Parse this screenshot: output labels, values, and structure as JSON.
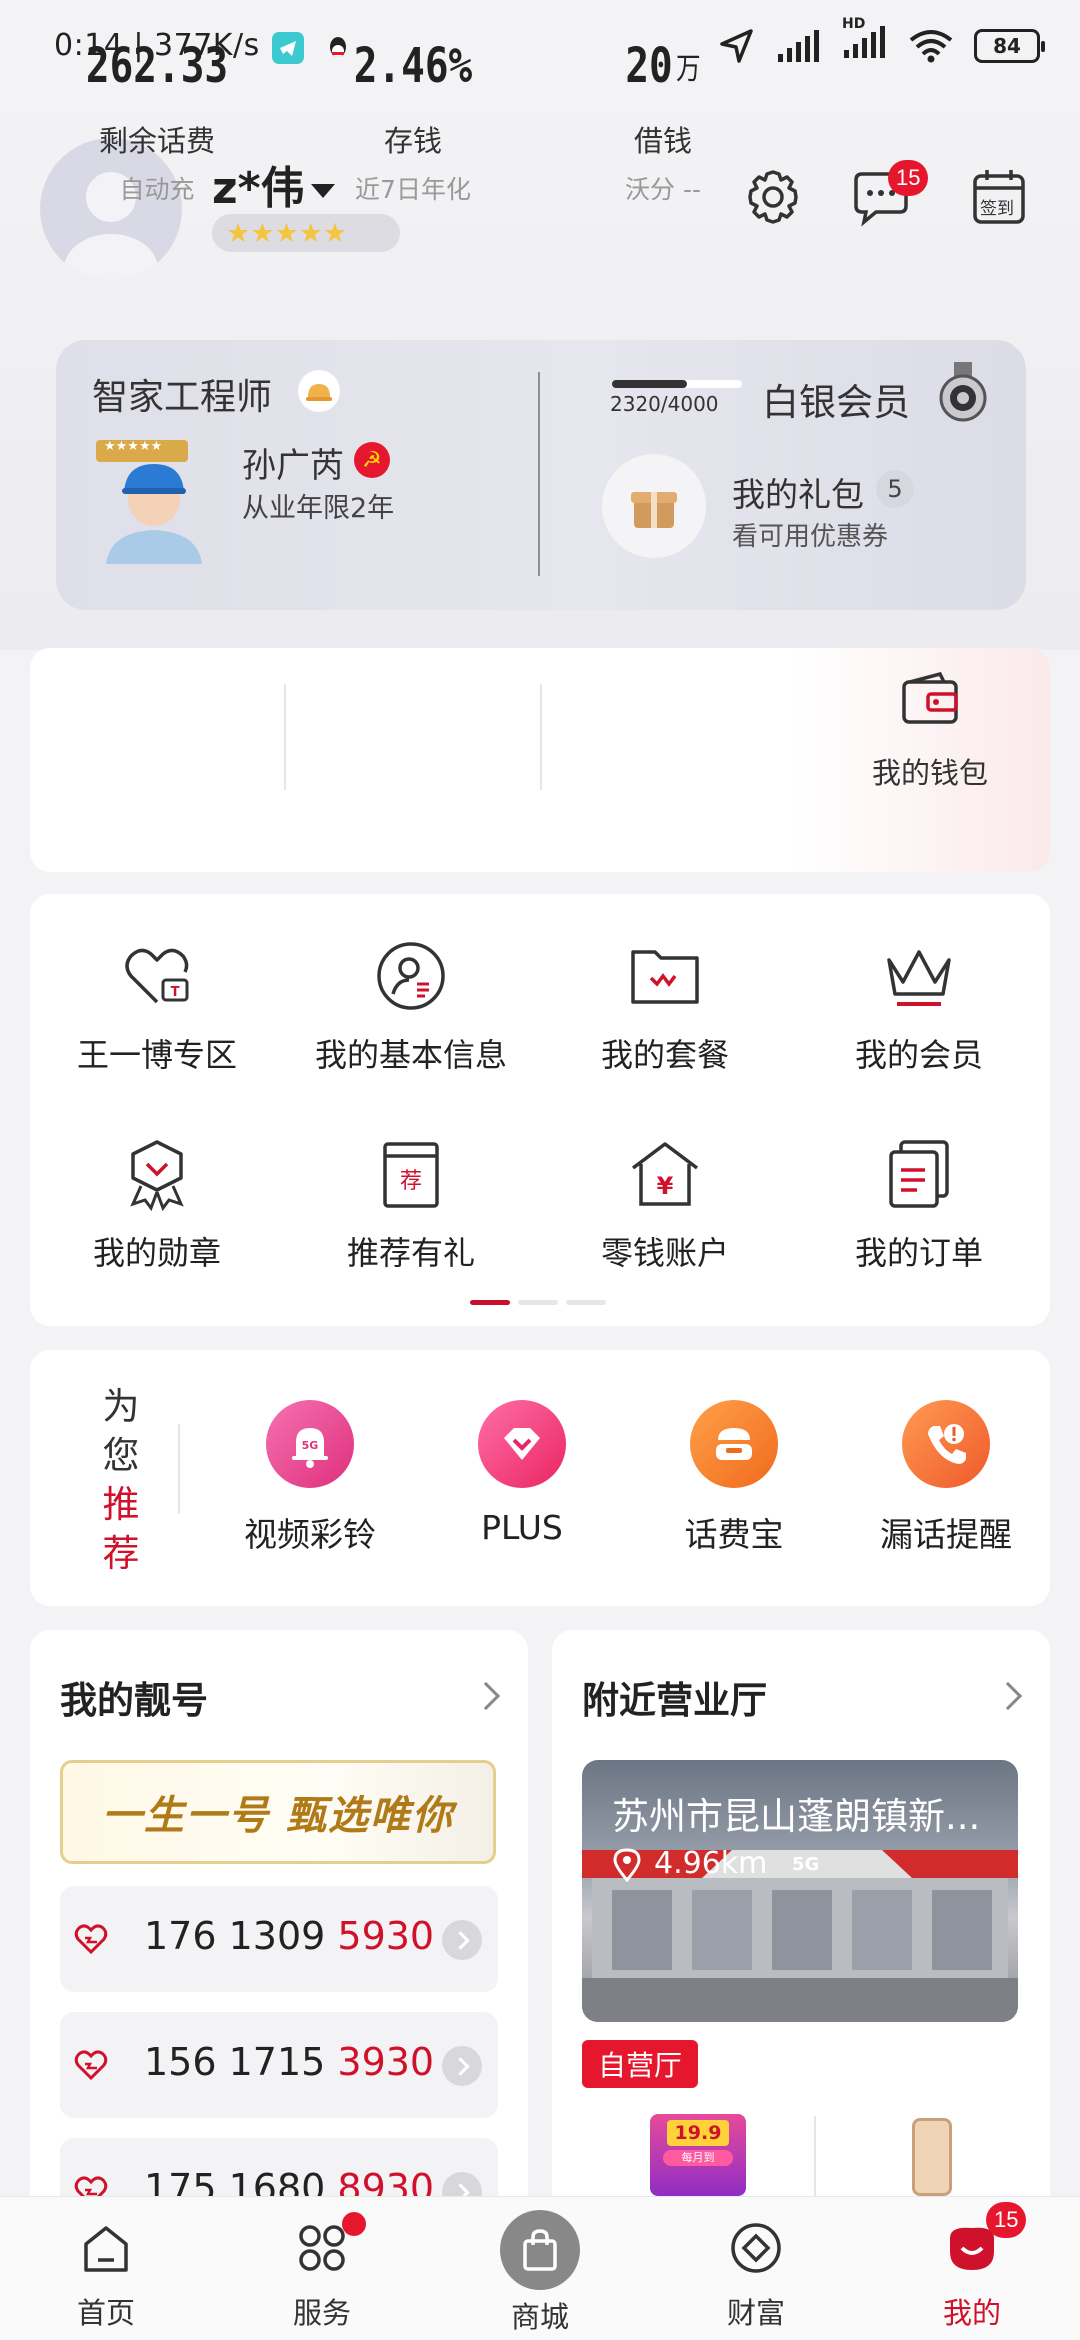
{
  "status_bar": {
    "time_speed": "0:14 | 377K/s",
    "battery": "84",
    "hd": "HD"
  },
  "profile": {
    "username": "z*伟",
    "stars": "★★★★★",
    "message_badge": "15",
    "checkin_label": "签到"
  },
  "member_card": {
    "title": "智家工程师",
    "engineer_name": "孙广芮",
    "engineer_years": "从业年限2年",
    "engineer_stars": "★★★★★",
    "points": "2320/4000",
    "points_progress": 0.58,
    "tier": "白银会员",
    "gift_title": "我的礼包",
    "gift_count": "5",
    "gift_sub": "看可用优惠券"
  },
  "stats": [
    {
      "value": "262.33",
      "unit": "",
      "label": "剩余话费",
      "sub": "自动充"
    },
    {
      "value": "2.46%",
      "unit": "",
      "label": "存钱",
      "sub": "近7日年化"
    },
    {
      "value": "20",
      "unit": "万",
      "label": "借钱",
      "sub": "沃分 --"
    }
  ],
  "wallet_label": "我的钱包",
  "menu": [
    {
      "label": "王一博专区",
      "icon": "heart-tv-icon"
    },
    {
      "label": "我的基本信息",
      "icon": "user-info-icon"
    },
    {
      "label": "我的套餐",
      "icon": "folder-plan-icon"
    },
    {
      "label": "我的会员",
      "icon": "crown-icon"
    },
    {
      "label": "我的勋章",
      "icon": "medal-icon"
    },
    {
      "label": "推荐有礼",
      "icon": "recommend-gift-icon"
    },
    {
      "label": "零钱账户",
      "icon": "change-account-icon"
    },
    {
      "label": "我的订单",
      "icon": "orders-icon"
    }
  ],
  "menu_glyphs": {
    "recommend": "荐",
    "yuan": "¥"
  },
  "recommend": {
    "title_top": "为您",
    "title_bottom": "推荐",
    "items": [
      {
        "label": "视频彩铃",
        "icon": "video-ringtone-icon",
        "color": "#ec3f8a"
      },
      {
        "label": "PLUS",
        "icon": "plus-diamond-icon",
        "color": "#f43c7a"
      },
      {
        "label": "话费宝",
        "icon": "bill-treasure-icon",
        "color": "#f47a26"
      },
      {
        "label": "漏话提醒",
        "icon": "missed-call-icon",
        "color": "#f4733a"
      }
    ],
    "bell_text": "5G"
  },
  "numbers": {
    "title": "我的靓号",
    "slogan": "一生一号 甄选唯你",
    "items": [
      {
        "prefix": "176 1309 ",
        "tail": "5930"
      },
      {
        "prefix": "156 1715 ",
        "tail": "3930"
      },
      {
        "prefix": "175 1680 ",
        "tail": "8930"
      }
    ]
  },
  "store": {
    "title": "附近营业厅",
    "name": "苏州市昆山蓬朗镇新...",
    "distance": "4.96km",
    "tag": "自营厅",
    "sign": "5G",
    "promo_price": "19.9",
    "promo_sub": "每月到"
  },
  "tabbar": [
    {
      "label": "首页",
      "icon": "home-icon",
      "active": false
    },
    {
      "label": "服务",
      "icon": "service-icon",
      "active": false
    },
    {
      "label": "商城",
      "icon": "shopping-bag-icon",
      "active": false
    },
    {
      "label": "财富",
      "icon": "wealth-icon",
      "active": false
    },
    {
      "label": "我的",
      "icon": "my-profile-icon",
      "active": true
    }
  ],
  "tab_badge": "15",
  "colors": {
    "brand_red": "#d0112b",
    "badge_red": "#e6162d"
  }
}
